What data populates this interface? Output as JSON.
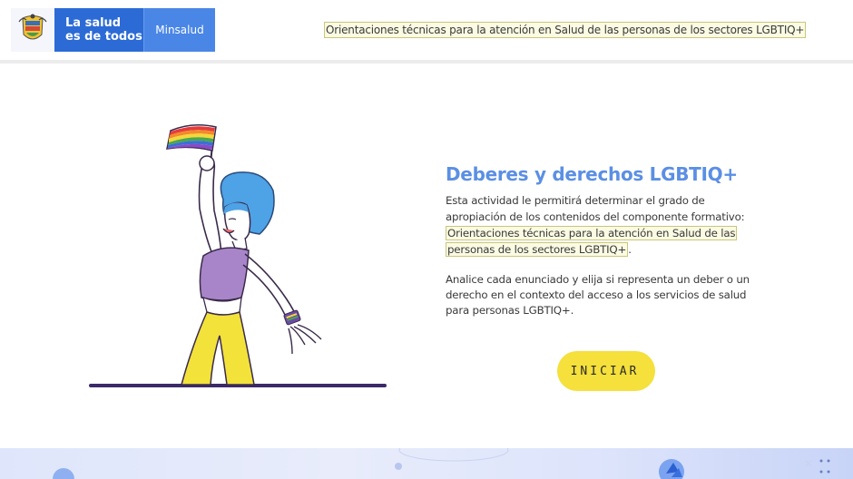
{
  "header": {
    "logo": {
      "line1": "La salud",
      "line2": "es de todos",
      "brand": "Minsalud"
    },
    "link_text": "Orientaciones técnicas para la atención en Salud de las personas de los sectores LGBTIQ+"
  },
  "main": {
    "title": "Deberes y derechos LGBTIQ+",
    "intro_text": "Esta actividad le permitirá determinar el grado de apropiación de los contenidos del componente formativo:",
    "intro_link": "Orientaciones técnicas para la atención en Salud de las personas de los sectores LGBTIQ+",
    "intro_end": ".",
    "instructions": "Analice cada enunciado y elija si representa un deber o un derecho en el contexto del acceso a los servicios de salud para personas LGBTIQ+.",
    "start_button": "INICIAR"
  },
  "colors": {
    "title": "#5b8fe4",
    "button": "#f5e03c",
    "logo_blue": "#2c6bd6",
    "highlight_bg": "#fbfbe4"
  },
  "icons": [
    "colombia-shield-icon",
    "rainbow-flag-icon",
    "woman-illustration",
    "pinwheel-icon"
  ]
}
